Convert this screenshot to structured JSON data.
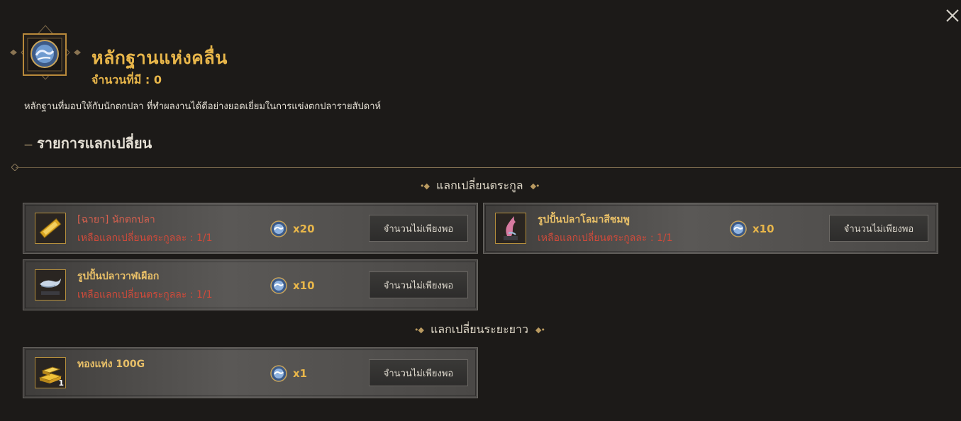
{
  "header": {
    "title": "หลักฐานแห่งคลื่น",
    "owned": "จำนวนที่มี : 0",
    "description": "หลักฐานที่มอบให้กับนักตกปลา ที่ทำผลงานได้ดีอย่างยอดเยี่ยมในการแข่งตกปลารายสัปดาห์",
    "icon": "wave-medal-icon"
  },
  "section": {
    "title": "รายการแลกเปลี่ยน"
  },
  "groups": [
    {
      "label": "แลกเปลี่ยนตระกูล",
      "items": [
        {
          "name": "[ฉายา] นักตกปลา",
          "limit": "เหลือแลกเปลี่ยนตระกูลละ : 1/1",
          "cost": "x20",
          "button": "จำนวนไม่เพียงพอ",
          "icon": "title-scroll-icon"
        },
        {
          "name": "รูปปั้นปลาโลมาสีชมพู",
          "limit": "เหลือแลกเปลี่ยนตระกูลละ : 1/1",
          "cost": "x10",
          "button": "จำนวนไม่เพียงพอ",
          "icon": "pink-dolphin-statue-icon"
        },
        {
          "name": "รูปปั้นปลาวาฬเผือก",
          "limit": "เหลือแลกเปลี่ยนตระกูลละ : 1/1",
          "cost": "x10",
          "button": "จำนวนไม่เพียงพอ",
          "icon": "white-whale-statue-icon"
        }
      ]
    },
    {
      "label": "แลกเปลี่ยนระยะยาว",
      "items": [
        {
          "name": "ทองแท่ง 100G",
          "cost": "x1",
          "button": "จำนวนไม่เพียงพอ",
          "qty": "1",
          "icon": "gold-bar-icon"
        }
      ]
    }
  ],
  "colors": {
    "accent": "#e8b64a",
    "limit_text": "#cf4a3a",
    "background": "#1c1a18"
  }
}
